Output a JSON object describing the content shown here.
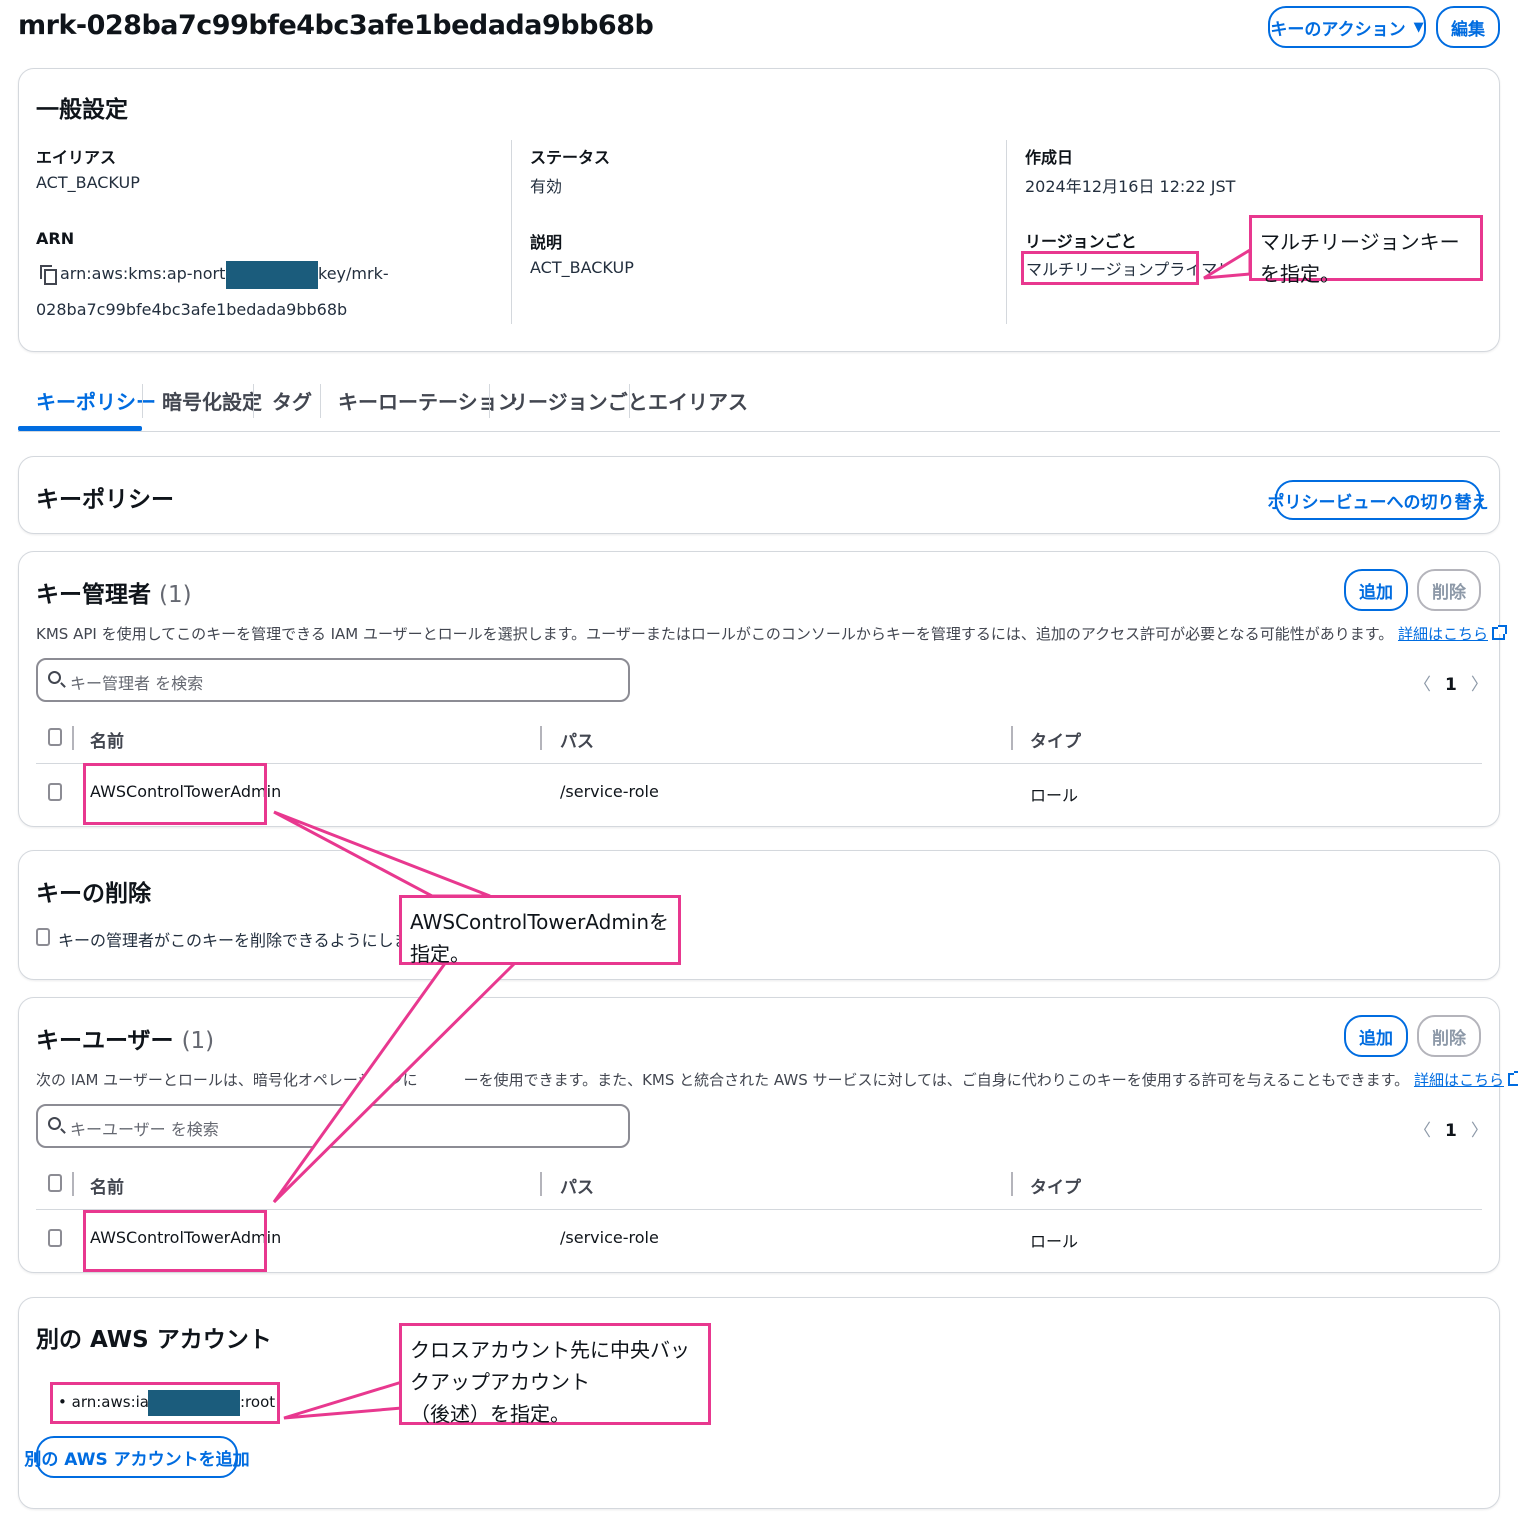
{
  "header": {
    "title": "mrk-028ba7c99bfe4bc3afe1bedada9bb68b",
    "key_actions_label": "キーのアクション",
    "edit_label": "編集"
  },
  "general": {
    "title": "一般設定",
    "alias_label": "エイリアス",
    "alias_value": "ACT_BACKUP",
    "arn_label": "ARN",
    "arn_prefix": "arn:aws:kms:ap-northeast-1:",
    "arn_suffix": "key/mrk-",
    "arn_line2": "028ba7c99bfe4bc3afe1bedada9bb68b",
    "status_label": "ステータス",
    "status_value": "有効",
    "description_label": "説明",
    "description_value": "ACT_BACKUP",
    "created_label": "作成日",
    "created_value": "2024年12月16日 12:22 JST",
    "regionality_label": "リージョンごと",
    "regionality_value": "マルチリージョンプライマリ"
  },
  "tabs": [
    "キーポリシー",
    "暗号化設定",
    "タグ",
    "キーローテーション",
    "リージョンごと",
    "エイリアス"
  ],
  "key_policy": {
    "title": "キーポリシー",
    "switch_view_label": "ポリシービューへの切り替え"
  },
  "key_admins": {
    "title": "キー管理者",
    "count": "(1)",
    "add_label": "追加",
    "delete_label": "削除",
    "description": "KMS API を使用してこのキーを管理できる IAM ユーザーとロールを選択します。ユーザーまたはロールがこのコンソールからキーを管理するには、追加のアクセス許可が必要となる可能性があります。",
    "learn_more": "詳細はこちら",
    "search_placeholder": "キー管理者 を検索",
    "page": "1",
    "columns": [
      "名前",
      "パス",
      "タイプ"
    ],
    "rows": [
      {
        "name": "AWSControlTowerAdmin",
        "path": "/service-role",
        "type": "ロール"
      }
    ]
  },
  "key_deletion": {
    "title": "キーの削除",
    "checkbox_label": "キーの管理者がこのキーを削除できるようにします"
  },
  "key_users": {
    "title": "キーユーザー",
    "count": "(1)",
    "add_label": "追加",
    "delete_label": "削除",
    "description_a": "次の IAM ユーザーとロールは、暗号化オペレーションに",
    "description_b": "ーを使用できます。また、KMS と統合された AWS サービスに対しては、ご自身に代わりこのキーを使用する許可を与えることもできます。",
    "learn_more": "詳細はこちら",
    "search_placeholder": "キーユーザー を検索",
    "page": "1",
    "columns": [
      "名前",
      "パス",
      "タイプ"
    ],
    "rows": [
      {
        "name": "AWSControlTowerAdmin",
        "path": "/service-role",
        "type": "ロール"
      }
    ]
  },
  "other_accounts": {
    "title": "別の AWS アカウント",
    "account_prefix": "arn:aws:iam::",
    "account_suffix": ":root",
    "add_label": "別の AWS アカウントを追加"
  },
  "annotations": {
    "multi_region": "マルチリージョンキーを指定。",
    "admin": "AWSControlTowerAdminを指定。",
    "cross_account_line1": "クロスアカウント先に中央バックアップアカウント",
    "cross_account_line2": "（後述）を指定。"
  },
  "colors": {
    "accent": "#006ce0",
    "annotation": "#e8388f",
    "redaction": "#1b5c7c"
  }
}
